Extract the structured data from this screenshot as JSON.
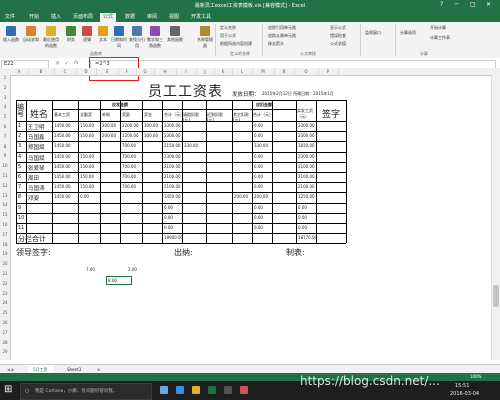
{
  "window": {
    "title": "最新员工excel工资表模板.xls [兼容模式] - Excel",
    "controls": [
      "?",
      "─",
      "□",
      "✕"
    ]
  },
  "tabs": [
    "文件",
    "开始",
    "插入",
    "页面布局",
    "公式",
    "数据",
    "审阅",
    "视图",
    "开发工具"
  ],
  "active_tab": "公式",
  "ribbon": {
    "buttons": [
      {
        "label": "插入函数",
        "icon": "fx-icon",
        "color": "#2f6fb0"
      },
      {
        "label": "自动求和",
        "icon": "sum-icon",
        "color": "#d9822b"
      },
      {
        "label": "最近使用的函数",
        "icon": "star-icon",
        "color": "#d9b12b"
      },
      {
        "label": "财务",
        "icon": "book-icon",
        "color": "#3a8a3a"
      },
      {
        "label": "逻辑",
        "icon": "book-icon",
        "color": "#c94b4b"
      },
      {
        "label": "文本",
        "icon": "book-icon",
        "color": "#e0a020"
      },
      {
        "label": "日期和时间",
        "icon": "clock-icon",
        "color": "#2f6fb0"
      },
      {
        "label": "查找与引用",
        "icon": "book-icon",
        "color": "#4a7ab0"
      },
      {
        "label": "数学和三角函数",
        "icon": "book-icon",
        "color": "#8a4ab0"
      },
      {
        "label": "其他函数",
        "icon": "book-icon",
        "color": "#666666"
      },
      {
        "label": "名称管理器",
        "icon": "tag-icon",
        "color": "#b08a2f"
      }
    ],
    "small_items": [
      "定义名称",
      "用于公式",
      "根据所选内容创建",
      "追踪引用单元格",
      "追踪从属单元格",
      "移去箭头",
      "显示公式",
      "错误检查",
      "公式求值",
      "监视窗口",
      "计算选项",
      "开始计算",
      "计算工作表"
    ],
    "groups": [
      "函数库",
      "定义的名称",
      "公式审核",
      "计算"
    ]
  },
  "formula_bar": {
    "name_box": "E22",
    "formula": "=2^3"
  },
  "columns": [
    "A",
    "B",
    "C",
    "D",
    "E",
    "F",
    "G",
    "H",
    "I",
    "J",
    "K",
    "L",
    "M",
    "N",
    "O",
    "P"
  ],
  "rows": [
    "1",
    "2",
    "3",
    "4",
    "5",
    "6",
    "7",
    "8",
    "9",
    "10",
    "11",
    "12",
    "13",
    "14",
    "15",
    "16",
    "17",
    "18",
    "19",
    "20",
    "21",
    "22",
    "23",
    "24",
    "25",
    "26",
    "27",
    "28",
    "29"
  ],
  "sheet": {
    "title": "员工工资表",
    "period_label": "发放日期：",
    "period_value": "2015年2月12日  所属日期：2015年1月",
    "header_due": "应发金额",
    "header_deduct": "应扣金额",
    "header_no": "编号",
    "header_name": "姓名",
    "header_actual": "实发工资（元）",
    "header_sign": "签字",
    "sub_due": [
      "基本工资",
      "全勤奖",
      "补助",
      "奖励",
      "奖金",
      "合计（元）"
    ],
    "sub_deduct": [
      "请假扣款(元)",
      "迟到扣款(元)",
      "其它扣款(元)",
      "合计（元）"
    ],
    "rows": [
      {
        "no": "1",
        "name": "王卫明",
        "base": "1450.00",
        "full": "150.00",
        "sub": "200.00",
        "reward": "1200.00",
        "bonus": "300.00",
        "due_total": "3300.00",
        "leave": "",
        "late": "",
        "other": "",
        "ded_total": "0.00",
        "actual": "3300.00"
      },
      {
        "no": "2",
        "name": "马国鑫",
        "base": "1450.00",
        "full": "150.00",
        "sub": "200.00",
        "reward": "1200.00",
        "bonus": "300.00",
        "due_total": "3300.00",
        "leave": "",
        "late": "",
        "other": "",
        "ded_total": "0.00",
        "actual": "3300.00"
      },
      {
        "no": "3",
        "name": "郑国斌",
        "base": "1450.00",
        "full": "",
        "sub": "",
        "reward": "700.00",
        "bonus": "",
        "due_total": "2150.00",
        "leave": "330.00",
        "late": "",
        "other": "",
        "ded_total": "330.00",
        "actual": "1820.00"
      },
      {
        "no": "4",
        "name": "马国斌",
        "base": "1450.00",
        "full": "150.00",
        "sub": "",
        "reward": "700.00",
        "bonus": "",
        "due_total": "2300.00",
        "leave": "",
        "late": "",
        "other": "",
        "ded_total": "0.00",
        "actual": "2300.00"
      },
      {
        "no": "5",
        "name": "张爱琴",
        "base": "1450.00",
        "full": "150.00",
        "sub": "",
        "reward": "700.00",
        "bonus": "",
        "due_total": "2100.00",
        "leave": "",
        "late": "",
        "other": "",
        "ded_total": "0.00",
        "actual": "2100.00"
      },
      {
        "no": "6",
        "name": "周田",
        "base": "1450.00",
        "full": "150.00",
        "sub": "",
        "reward": "700.00",
        "bonus": "",
        "due_total": "2100.00",
        "leave": "",
        "late": "",
        "other": "",
        "ded_total": "0.00",
        "actual": "2100.00"
      },
      {
        "no": "7",
        "name": "马国涛",
        "base": "1450.00",
        "full": "150.00",
        "sub": "",
        "reward": "700.00",
        "bonus": "",
        "due_total": "2100.00",
        "leave": "",
        "late": "",
        "other": "",
        "ded_total": "0.00",
        "actual": "2100.00"
      },
      {
        "no": "8",
        "name": "邓姿",
        "base": "1450.00",
        "full": "0.00",
        "sub": "",
        "reward": "",
        "bonus": "",
        "due_total": "1450.00",
        "leave": "",
        "late": "",
        "other": "200.00",
        "ded_total": "200.00",
        "actual": "1250.00"
      },
      {
        "no": "9",
        "name": "",
        "base": "",
        "full": "",
        "sub": "",
        "reward": "",
        "bonus": "",
        "due_total": "0.00",
        "leave": "",
        "late": "",
        "other": "",
        "ded_total": "0.00",
        "actual": "0.00"
      },
      {
        "no": "10",
        "name": "",
        "base": "",
        "full": "",
        "sub": "",
        "reward": "",
        "bonus": "",
        "due_total": "0.00",
        "leave": "",
        "late": "",
        "other": "",
        "ded_total": "0.00",
        "actual": "0.00"
      },
      {
        "no": "11",
        "name": "",
        "base": "",
        "full": "",
        "sub": "",
        "reward": "",
        "bonus": "",
        "due_total": "0.00",
        "leave": "",
        "late": "",
        "other": "",
        "ded_total": "0.00",
        "actual": "0.00"
      }
    ],
    "subtotal_label": "分栏合计",
    "subtotal_due": "18900.00",
    "subtotal_actual": "18770.00",
    "footer_leader": "领导签字:",
    "footer_cashier": "出纳:",
    "footer_maker": "制表:",
    "extra_values": [
      "7.00",
      "2.00",
      "8.00"
    ]
  },
  "sheet_tabs": [
    "5月工资",
    "Sheet3"
  ],
  "status": {
    "zoom": "100%"
  },
  "taskbar": {
    "search": "我是 Cortana，小娜。有问题尽管问我。",
    "time": "15:51",
    "date": "2016-03-04"
  },
  "watermark": "https://blog.csdn.net/..."
}
